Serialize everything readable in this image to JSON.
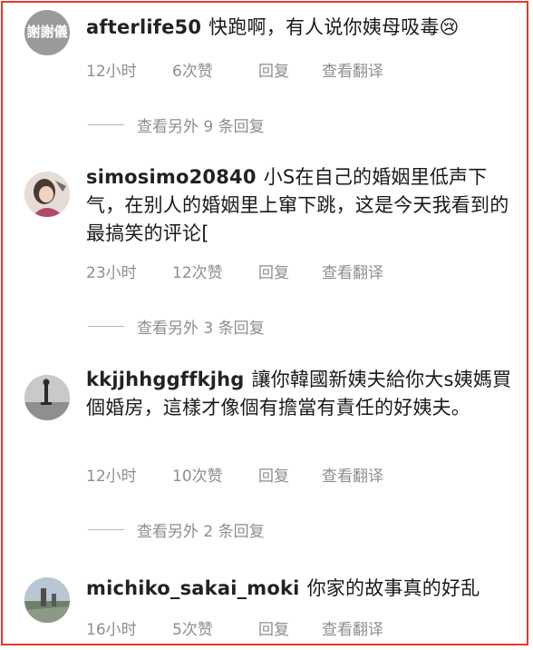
{
  "comments": [
    {
      "username": "afterlife50",
      "text": "快跑啊，有人说你姨母吸毒😢",
      "time": "12小时",
      "likes": "6次赞",
      "reply": "回复",
      "translate": "查看翻译",
      "more_replies": "查看另外 9 条回复"
    },
    {
      "username": "simosimo20840",
      "text": "小S在自己的婚姻里低声下气，在别人的婚姻里上窜下跳，这是今天我看到的最搞笑的评论[",
      "time": "23小时",
      "likes": "12次赞",
      "reply": "回复",
      "translate": "查看翻译",
      "more_replies": "查看另外 3 条回复"
    },
    {
      "username": "kkjjhhggffkjhg",
      "text": "讓你韓國新姨夫給你大s姨媽買個婚房，這樣才像個有擔當有責任的好姨夫。",
      "time": "12小时",
      "likes": "10次赞",
      "reply": "回复",
      "translate": "查看翻译",
      "more_replies": "查看另外 2 条回复"
    },
    {
      "username": "michiko_sakai_moki",
      "text": "你家的故事真的好乱",
      "time": "16小时",
      "likes": "5次赞",
      "reply": "回复",
      "translate": "查看翻译"
    }
  ],
  "avatar0_text": "謝謝儀",
  "colors": {
    "border": "#e23a2b",
    "meta": "#8e8e8e"
  }
}
